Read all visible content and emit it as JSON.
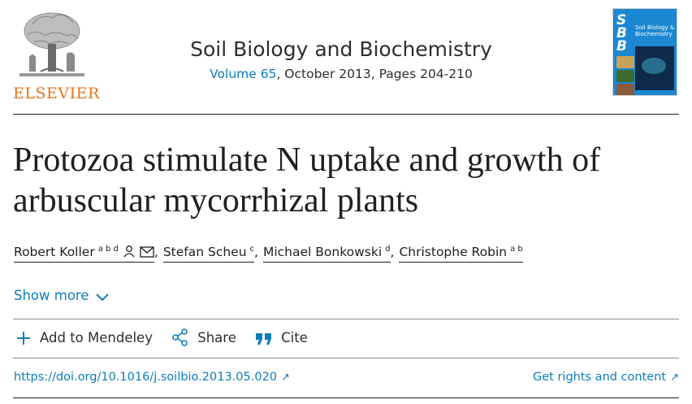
{
  "header": {
    "publisher_name": "ELSEVIER",
    "journal_title": "Soil Biology and Biochemistry",
    "volume_link": "Volume 65",
    "issue_details": ", October 2013, Pages 204-210",
    "cover": {
      "letters": [
        "S",
        "B",
        "B"
      ],
      "title": "Soil Biology & Biochemistry",
      "color": "#1b88d1"
    }
  },
  "article": {
    "title": "Protozoa stimulate N uptake and growth of arbuscular mycorrhizal plants"
  },
  "authors": [
    {
      "name": "Robert Koller",
      "affiliations": "a b d",
      "icons": [
        "person-icon",
        "mail-icon"
      ]
    },
    {
      "name": "Stefan Scheu",
      "affiliations": "c"
    },
    {
      "name": "Michael Bonkowski",
      "affiliations": "d"
    },
    {
      "name": "Christophe Robin",
      "affiliations": "a b"
    }
  ],
  "author_separator": ",",
  "show_more": {
    "label": "Show more"
  },
  "actions": {
    "mendeley": "Add to Mendeley",
    "share": "Share",
    "cite": "Cite"
  },
  "links": {
    "doi": "https://doi.org/10.1016/j.soilbio.2013.05.020",
    "rights": "Get rights and content",
    "external_arrow": "↗"
  },
  "colors": {
    "link": "#0c7dbb",
    "publisher_orange": "#e9711c",
    "text": "#1f1f1f"
  }
}
